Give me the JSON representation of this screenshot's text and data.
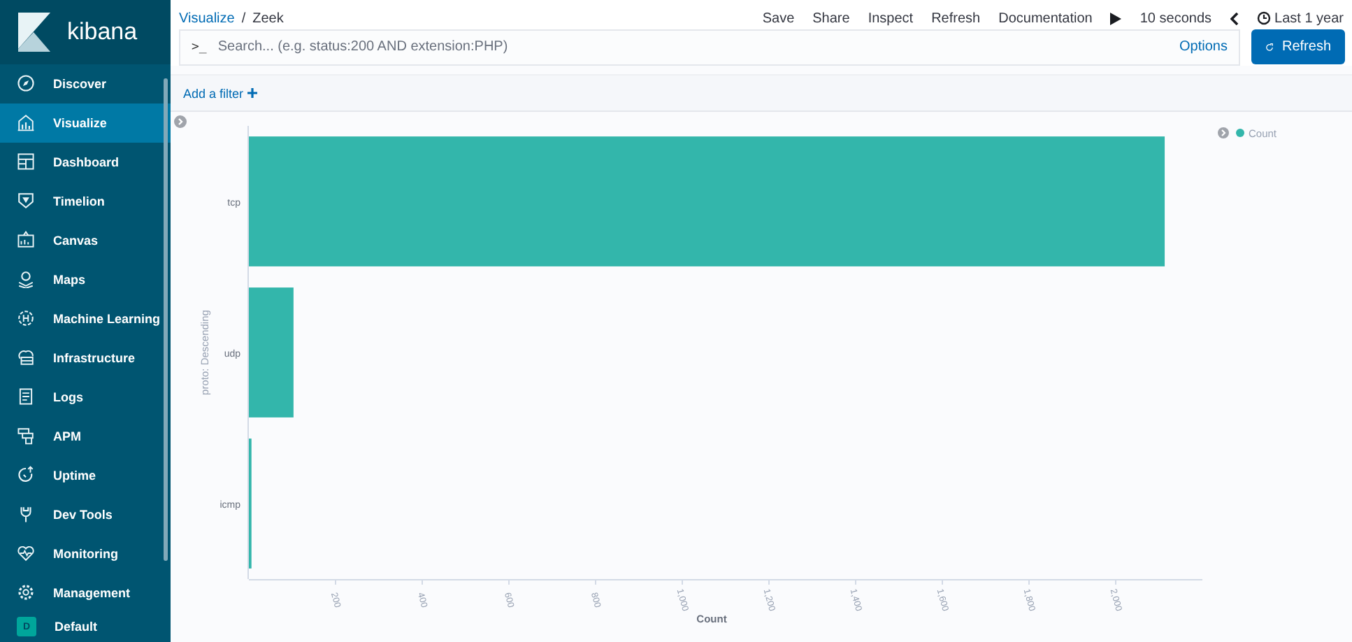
{
  "app": {
    "logo_text": "kibana"
  },
  "nav": [
    {
      "label": "Discover",
      "selected": false
    },
    {
      "label": "Visualize",
      "selected": true
    },
    {
      "label": "Dashboard",
      "selected": false
    },
    {
      "label": "Timelion",
      "selected": false
    },
    {
      "label": "Canvas",
      "selected": false
    },
    {
      "label": "Maps",
      "selected": false
    },
    {
      "label": "Machine Learning",
      "selected": false
    },
    {
      "label": "Infrastructure",
      "selected": false
    },
    {
      "label": "Logs",
      "selected": false
    },
    {
      "label": "APM",
      "selected": false
    },
    {
      "label": "Uptime",
      "selected": false
    },
    {
      "label": "Dev Tools",
      "selected": false
    },
    {
      "label": "Monitoring",
      "selected": false
    },
    {
      "label": "Management",
      "selected": false
    }
  ],
  "space": {
    "initial": "D",
    "label": "Default"
  },
  "breadcrumbs": [
    {
      "label": "Visualize",
      "kind": "link"
    },
    {
      "label": "Zeek",
      "kind": "current"
    }
  ],
  "breadcrumb_separator": "/",
  "top_menu": [
    "Save",
    "Share",
    "Inspect",
    "Refresh",
    "Documentation"
  ],
  "refresh_interval": "10 seconds",
  "time_range": "Last 1 year",
  "query_bar": {
    "prompt": ">_",
    "placeholder": "Search... (e.g. status:200 AND extension:PHP)",
    "options": "Options",
    "button": "Refresh"
  },
  "filter_bar": {
    "add_filter": "Add a filter"
  },
  "chart": {
    "chart_data": {
      "type": "bar",
      "orientation": "horizontal",
      "categories": [
        "tcp",
        "udp",
        "icmp"
      ],
      "series": [
        {
          "name": "Count",
          "color": "#33b6ab",
          "values": [
            2113,
            103,
            6
          ]
        }
      ],
      "xlabel": "Count",
      "ylabel": "proto: Descending",
      "xlim": [
        0,
        2200
      ],
      "xticks": [
        {
          "value": 200,
          "label": "200"
        },
        {
          "value": 400,
          "label": "400"
        },
        {
          "value": 600,
          "label": "600"
        },
        {
          "value": 800,
          "label": "800"
        },
        {
          "value": 1000,
          "label": "1,000"
        },
        {
          "value": 1200,
          "label": "1,200"
        },
        {
          "value": 1400,
          "label": "1,400"
        },
        {
          "value": 1600,
          "label": "1,600"
        },
        {
          "value": 1800,
          "label": "1,800"
        },
        {
          "value": 2000,
          "label": "2,000"
        }
      ]
    }
  }
}
